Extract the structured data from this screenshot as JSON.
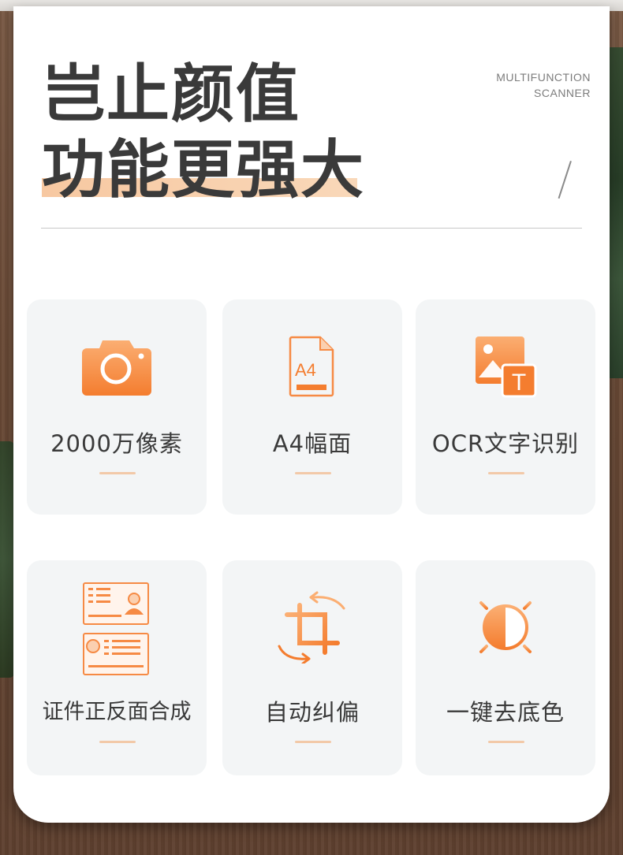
{
  "hero": {
    "line1": "岂止颜值",
    "line2": "功能更强大"
  },
  "subtitle": {
    "line1": "MULTIFUNCTION",
    "line2": "SCANNER"
  },
  "features": [
    {
      "label": "2000万像素",
      "icon": "camera-icon"
    },
    {
      "label": "A4幅面",
      "icon": "a4-document-icon",
      "icon_text": "A4"
    },
    {
      "label": "OCR文字识别",
      "icon": "ocr-image-text-icon",
      "icon_text": "T"
    },
    {
      "label": "证件正反面合成",
      "icon": "id-card-front-back-icon"
    },
    {
      "label": "自动纠偏",
      "icon": "crop-rotate-icon"
    },
    {
      "label": "一键去底色",
      "icon": "brightness-contrast-icon"
    }
  ],
  "colors": {
    "accent_orange": "#f7873b",
    "accent_light": "#fbb27f",
    "title_text": "#3a3a3a",
    "card_bg": "#f3f5f6",
    "highlight": "#f7c8a1"
  }
}
